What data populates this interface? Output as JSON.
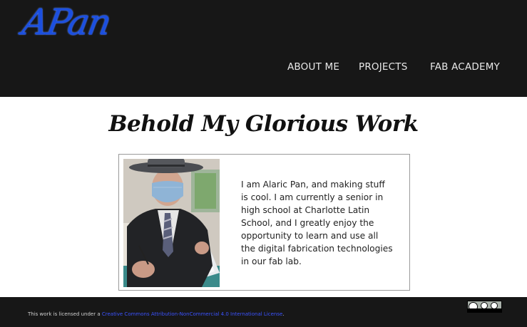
{
  "header": {
    "logo_text": "APan",
    "nav": [
      {
        "label": "ABOUT ME"
      },
      {
        "label": "PROJECTS"
      },
      {
        "label": "FAB ACADEMY"
      }
    ]
  },
  "main": {
    "heading": "Behold My Glorious Work",
    "bio": "I am Alaric Pan, and making stuff is cool. I am currently a senior in high school at Charlotte Latin School, and I greatly enjoy the opportunity to learn and use all the digital fabrication technologies in our fab lab."
  },
  "footer": {
    "license_prefix": "This work is licensed under a ",
    "license_link": "Creative Commons Attribution-NonCommercial 4.0 International License",
    "license_suffix": ".",
    "badge_icon": "cc-by-nc-icon"
  },
  "colors": {
    "header_bg": "#171717",
    "logo": "#1b4fe0",
    "link": "#3b53ff"
  }
}
